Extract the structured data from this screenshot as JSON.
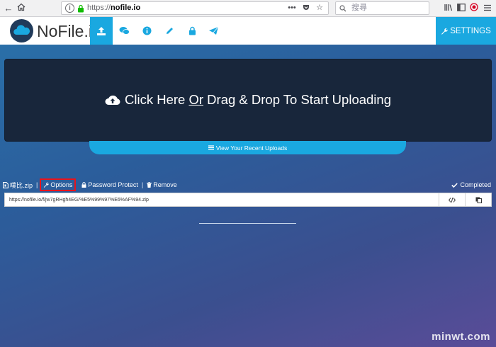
{
  "browser": {
    "url_prefix": "https://",
    "url_host": "nofile.io",
    "search_placeholder": "搜尋",
    "more_label": "•••"
  },
  "header": {
    "brand": "NoFile.io",
    "settings_label": "SETTINGS",
    "nav_tabs": [
      "upload-icon",
      "chat-icon",
      "info-icon",
      "pencil-icon",
      "lock-icon",
      "send-icon"
    ],
    "accent_color": "#1aa8e0"
  },
  "upload": {
    "text_before": "Click Here ",
    "text_or": "Or",
    "text_after": " Drag & Drop To Start Uploading",
    "recent_label": "View Your Recent Uploads"
  },
  "file": {
    "name": "噗比.zip",
    "options_label": "Options",
    "password_label": "Password Protect",
    "remove_label": "Remove",
    "separator": "|",
    "status": "Completed",
    "link": "https://nofile.io/f/jw7gRHgh4EG/%E5%99%97%E6%AF%94.zip"
  },
  "watermark": "minwt.com"
}
